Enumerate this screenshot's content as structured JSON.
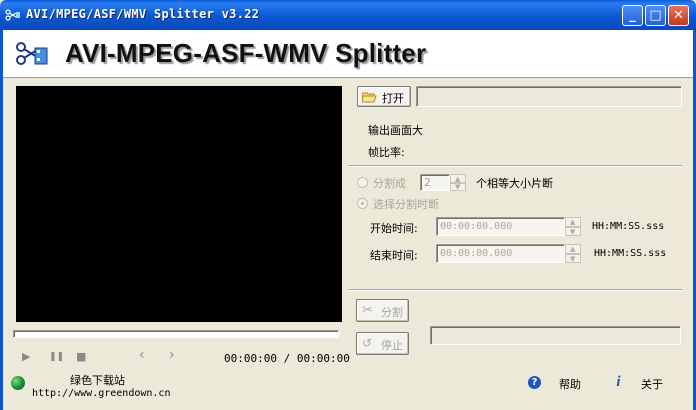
{
  "window": {
    "title": "AVI/MPEG/ASF/WMV Splitter v3.22",
    "minimize_glyph": "_",
    "maximize_glyph": "□",
    "close_glyph": "✕"
  },
  "banner": {
    "title": "AVI-MPEG-ASF-WMV Splitter"
  },
  "player": {
    "play_icon": "▶",
    "pause_icon": "❚❚",
    "stop_icon": "■",
    "prev_icon": "‹",
    "next_icon": "›",
    "time": "00:00:00 / 00:00:00"
  },
  "file": {
    "open_label": "打开",
    "path_value": ""
  },
  "info": {
    "output_size_label": "输出画面大",
    "ratio_label": "帧比率:"
  },
  "split": {
    "equal_parts_label": "分割成",
    "equal_parts_value": "2",
    "equal_parts_suffix": "个相等大小片断",
    "choose_time_label": "选择分割时断",
    "start_label": "开始时间:",
    "start_value": "00:00:00.000",
    "end_label": "结束时间:",
    "end_value": "00:00:00.000",
    "format_hint": "HH:MM:SS.sss",
    "split_button": "分割",
    "stop_button": "停止",
    "progress": 0
  },
  "footer": {
    "site_name": "绿色下载站",
    "site_url": "http://www.greendown.cn",
    "help_label": "帮助",
    "about_label": "关于"
  },
  "colors": {
    "titlebar": "#0b57d0",
    "dialog_bg": "#ece9d8",
    "video_bg": "#000000"
  }
}
